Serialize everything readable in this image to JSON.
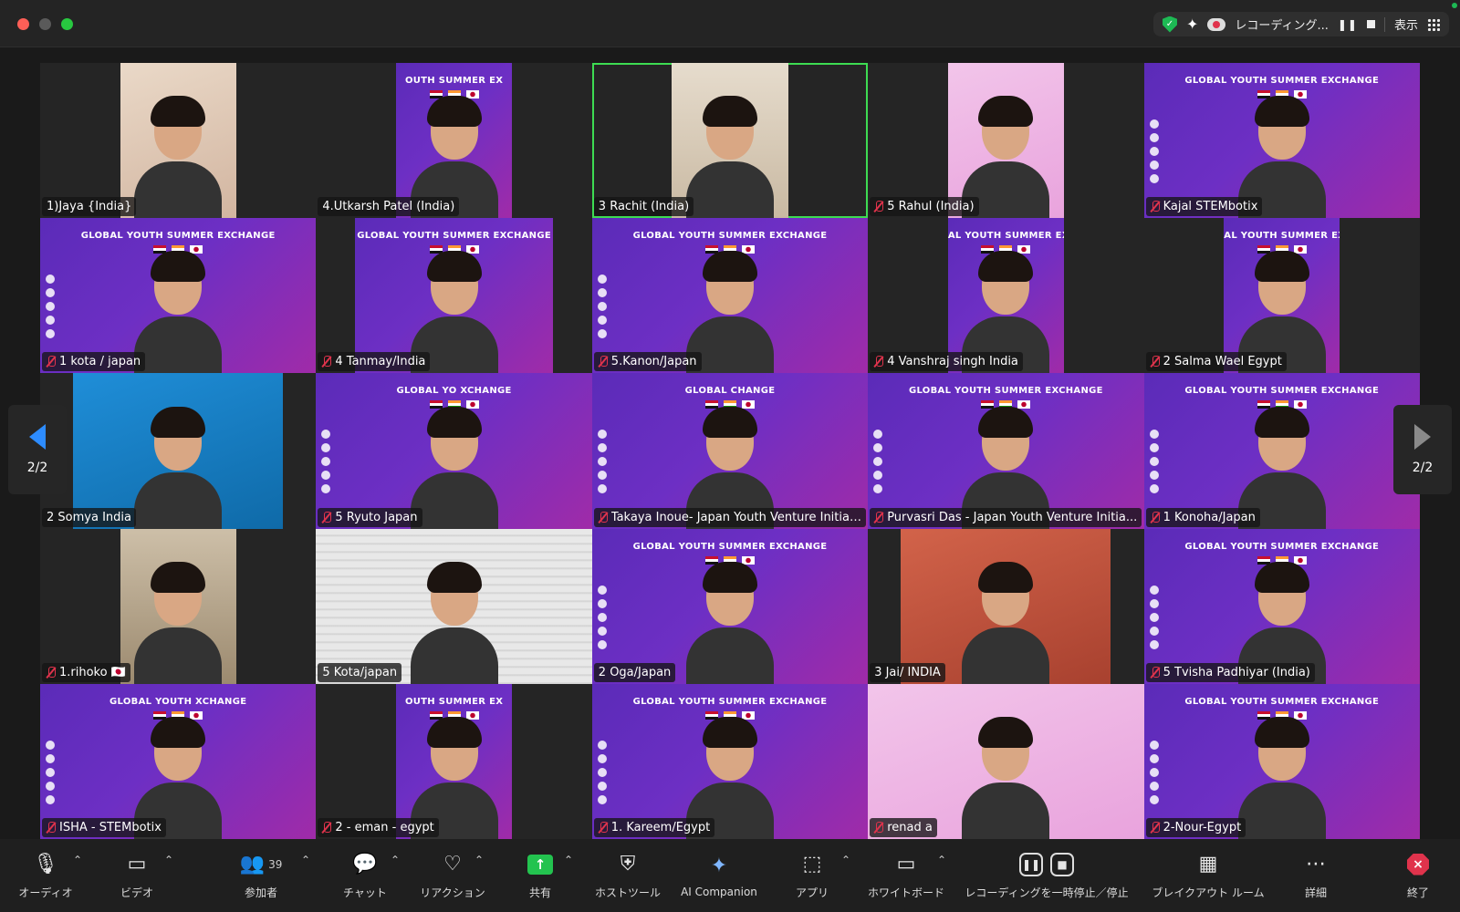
{
  "titlebar": {
    "recording_label": "レコーディング...",
    "view_label": "表示"
  },
  "gallery": {
    "page_indicator": "2/2",
    "tiles": [
      {
        "name": "1)Jaya {India}",
        "muted": false,
        "bg": "room",
        "fit": "narrow",
        "banner": ""
      },
      {
        "name": "4.Utkarsh Patel (India)",
        "muted": false,
        "bg": "purple",
        "fit": "narrow",
        "banner": "OUTH SUMMER EX"
      },
      {
        "name": "3 Rachit (India)",
        "muted": false,
        "bg": "cream",
        "fit": "narrow",
        "banner": "",
        "active": true
      },
      {
        "name": "5 Rahul (India)",
        "muted": true,
        "bg": "pink",
        "fit": "narrow",
        "banner": ""
      },
      {
        "name": "Kajal STEMbotix",
        "muted": true,
        "bg": "purple",
        "fit": "full",
        "banner": "GLOBAL YOUTH SUMMER EXCHANGE"
      },
      {
        "name": "1 kota / japan",
        "muted": true,
        "bg": "purple",
        "fit": "full",
        "banner": "GLOBAL YOUTH SUMMER EXCHANGE"
      },
      {
        "name": "4 Tanmay/India",
        "muted": true,
        "bg": "purple",
        "fit": "mid",
        "banner": "GLOBAL YOUTH SUMMER EXCHANGE"
      },
      {
        "name": "5.Kanon/Japan",
        "muted": true,
        "bg": "purple",
        "fit": "full",
        "banner": "GLOBAL YOUTH SUMMER EXCHANGE"
      },
      {
        "name": "4 Vanshraj singh India",
        "muted": true,
        "bg": "purple",
        "fit": "narrow",
        "banner": "AL YOUTH SUMMER EXCH"
      },
      {
        "name": "2 Salma Wael Egypt",
        "muted": true,
        "bg": "purple",
        "fit": "narrow",
        "banner": "AL YOUTH SUMMER EXCH"
      },
      {
        "name": "2  Somya  India",
        "muted": false,
        "bg": "blue",
        "fit": "wide",
        "banner": ""
      },
      {
        "name": "5 Ryuto Japan",
        "muted": true,
        "bg": "purple",
        "fit": "full",
        "banner": "GLOBAL YO             XCHANGE"
      },
      {
        "name": "Takaya Inoue- Japan Youth Venture Initiat...",
        "muted": true,
        "bg": "purple",
        "fit": "full",
        "banner": "GLOBAL                    CHANGE"
      },
      {
        "name": "Purvasri Das - Japan Youth Venture Initia...",
        "muted": true,
        "bg": "purple",
        "fit": "full",
        "banner": "GLOBAL YOUTH SUMMER EXCHANGE"
      },
      {
        "name": "1 Konoha/Japan",
        "muted": true,
        "bg": "purple",
        "fit": "full",
        "banner": "GLOBAL YOUTH SUMMER EXCHANGE"
      },
      {
        "name": "1.rihoko 🇯🇵",
        "muted": true,
        "bg": "wall",
        "fit": "narrow",
        "banner": ""
      },
      {
        "name": "5 Kota/japan",
        "muted": false,
        "bg": "blinds",
        "fit": "full",
        "banner": ""
      },
      {
        "name": "2 Oga/Japan",
        "muted": false,
        "bg": "purple",
        "fit": "full",
        "banner": "GLOBAL YOUTH SUMMER EXCHANGE"
      },
      {
        "name": "3 Jai/ INDIA",
        "muted": false,
        "bg": "rust",
        "fit": "wide",
        "banner": ""
      },
      {
        "name": "5 Tvisha Padhiyar (India)",
        "muted": true,
        "bg": "purple",
        "fit": "full",
        "banner": "GLOBAL YOUTH SUMMER EXCHANGE"
      },
      {
        "name": "ISHA - STEMbotix",
        "muted": true,
        "bg": "purple",
        "fit": "full",
        "banner": "GLOBAL YOUTH         XCHANGE"
      },
      {
        "name": "2 - eman - egypt",
        "muted": true,
        "bg": "purple",
        "fit": "narrow",
        "banner": "OUTH SUMMER EX"
      },
      {
        "name": "1. Kareem/Egypt",
        "muted": true,
        "bg": "purple",
        "fit": "full",
        "banner": "GLOBAL YOUTH SUMMER EXCHANGE"
      },
      {
        "name": "renad a",
        "muted": true,
        "bg": "pink",
        "fit": "full",
        "banner": ""
      },
      {
        "name": "2-Nour-Egypt",
        "muted": true,
        "bg": "purple",
        "fit": "full",
        "banner": "GLOBAL YOUTH SUMMER EXCHANGE"
      }
    ]
  },
  "toolbar": {
    "audio": "オーディオ",
    "video": "ビデオ",
    "participants": "参加者",
    "participants_count": "39",
    "chat": "チャット",
    "reactions": "リアクション",
    "share": "共有",
    "host_tools": "ホストツール",
    "ai_companion": "AI Companion",
    "apps": "アプリ",
    "whiteboard": "ホワイトボード",
    "recording_control": "レコーディングを一時停止／停止",
    "breakout": "ブレイクアウト ルーム",
    "more": "詳細",
    "end": "終了"
  },
  "icons": {
    "security": "shield-icon",
    "ai": "sparkle-icon",
    "cloud_recording": "cloud-icon"
  },
  "colors": {
    "active_speaker": "#3ddc52",
    "muted": "#e0334c",
    "share": "#23c34f",
    "accent": "#2d8cff"
  }
}
